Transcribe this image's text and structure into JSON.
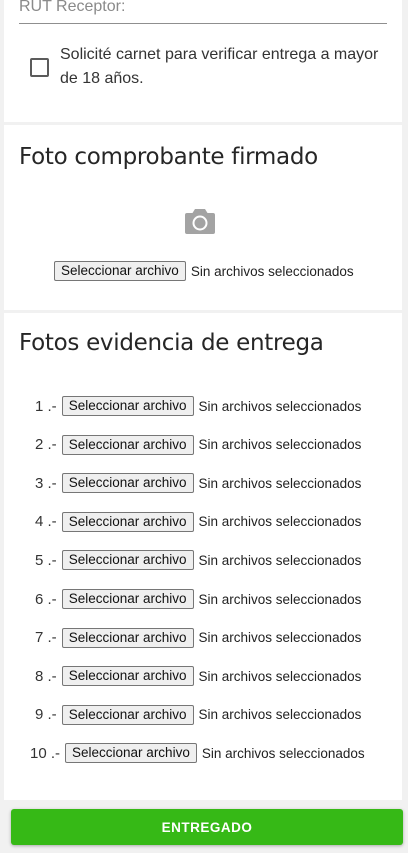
{
  "receptor": {
    "rut_label": "RUT Receptor:",
    "checkbox_text": "Solicité carnet para verificar entrega a mayor de 18 años."
  },
  "signed_receipt": {
    "title": "Foto comprobante firmado",
    "icon": "camera-icon",
    "button_label": "Seleccionar archivo",
    "status": "Sin archivos seleccionados"
  },
  "evidence": {
    "title": "Fotos evidencia de entrega",
    "items": [
      {
        "number": "1 .-",
        "button_label": "Seleccionar archivo",
        "status": "Sin archivos seleccionados"
      },
      {
        "number": "2 .-",
        "button_label": "Seleccionar archivo",
        "status": "Sin archivos seleccionados"
      },
      {
        "number": "3 .-",
        "button_label": "Seleccionar archivo",
        "status": "Sin archivos seleccionados"
      },
      {
        "number": "4 .-",
        "button_label": "Seleccionar archivo",
        "status": "Sin archivos seleccionados"
      },
      {
        "number": "5 .-",
        "button_label": "Seleccionar archivo",
        "status": "Sin archivos seleccionados"
      },
      {
        "number": "6 .-",
        "button_label": "Seleccionar archivo",
        "status": "Sin archivos seleccionados"
      },
      {
        "number": "7 .-",
        "button_label": "Seleccionar archivo",
        "status": "Sin archivos seleccionados"
      },
      {
        "number": "8 .-",
        "button_label": "Seleccionar archivo",
        "status": "Sin archivos seleccionados"
      },
      {
        "number": "9 .-",
        "button_label": "Seleccionar archivo",
        "status": "Sin archivos seleccionados"
      },
      {
        "number": "10 .-",
        "button_label": "Seleccionar archivo",
        "status": "Sin archivos seleccionados"
      }
    ]
  },
  "submit": {
    "label": "ENTREGADO",
    "color": "#36b916"
  }
}
